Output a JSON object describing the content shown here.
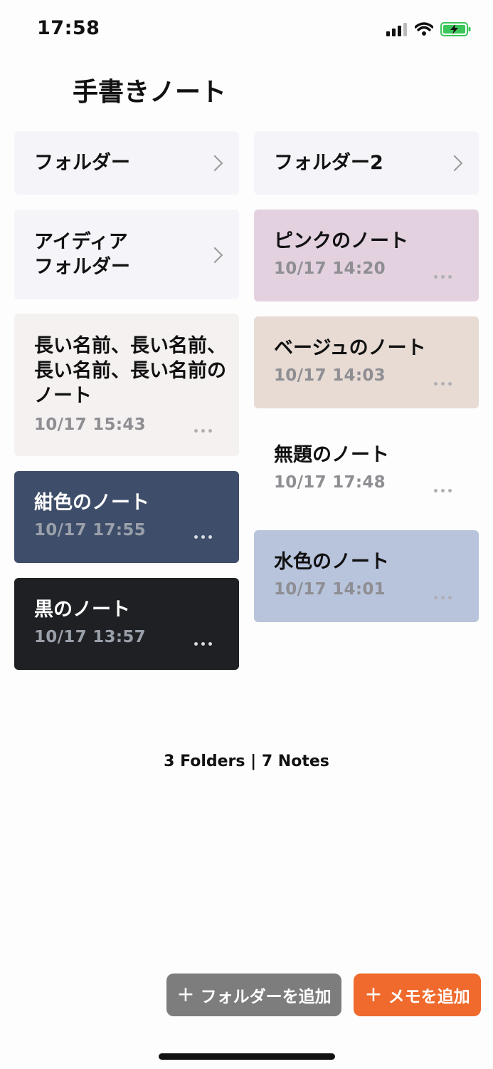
{
  "status_bar": {
    "time": "17:58"
  },
  "header": {
    "title": "手書きノート"
  },
  "left_column": [
    {
      "kind": "folder",
      "label": "フォルダー"
    },
    {
      "kind": "folder",
      "label": "アイディア\nフォルダー"
    },
    {
      "kind": "note",
      "title": "長い名前、長い名前、長い名前、長い名前のノート",
      "date": "10/17 15:43",
      "color": "#f4f1f0"
    },
    {
      "kind": "note",
      "title": "紺色のノート",
      "date": "10/17 17:55",
      "color": "#3e4d69"
    },
    {
      "kind": "note",
      "title": "黒のノート",
      "date": "10/17 13:57",
      "color": "#1f2024"
    }
  ],
  "right_column": [
    {
      "kind": "folder",
      "label": "フォルダー2"
    },
    {
      "kind": "note",
      "title": "ピンクのノート",
      "date": "10/17 14:20",
      "color": "#e3d1e0"
    },
    {
      "kind": "note",
      "title": "ベージュのノート",
      "date": "10/17 14:03",
      "color": "#e7dbd4"
    },
    {
      "kind": "note",
      "title": "無題のノート",
      "date": "10/17 17:48",
      "color": "#fdfdfd"
    },
    {
      "kind": "note",
      "title": "水色のノート",
      "date": "10/17 14:01",
      "color": "#b8c4dc"
    }
  ],
  "summary": "3 Folders | 7 Notes",
  "actions": {
    "add_folder_label": "フォルダーを追加",
    "add_memo_label": "メモを追加"
  }
}
